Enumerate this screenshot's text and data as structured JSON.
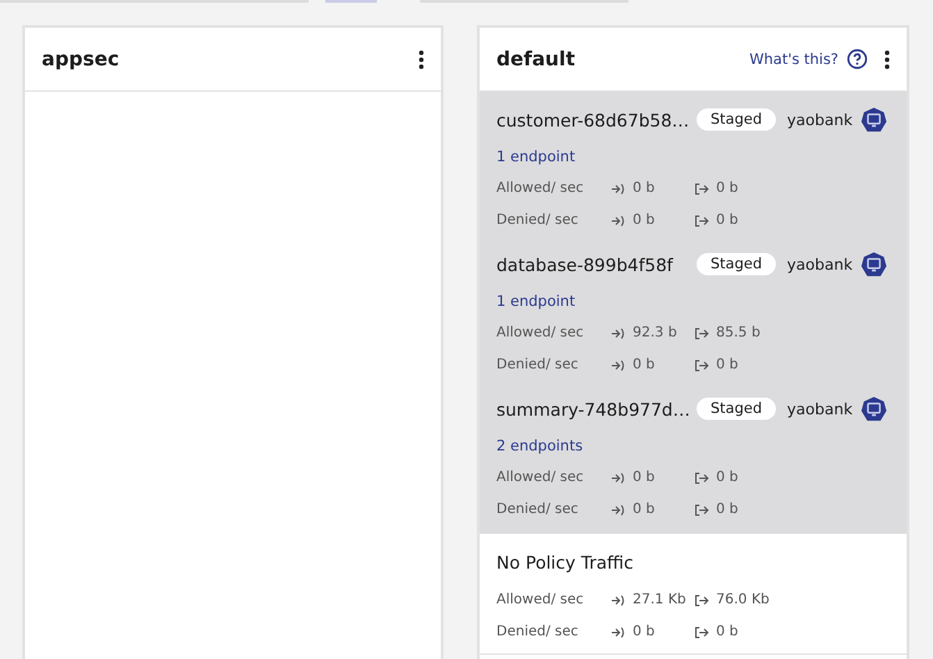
{
  "tiers": [
    {
      "name": "appsec"
    },
    {
      "name": "default",
      "help_link": "What's this?",
      "policies": [
        {
          "name": "customer-68d67b58…",
          "badge": "Staged",
          "namespace": "yaobank",
          "endpoints": "1 endpoint",
          "allowed_label": "Allowed/ sec",
          "allowed_in": "0 b",
          "allowed_out": "0 b",
          "denied_label": "Denied/ sec",
          "denied_in": "0 b",
          "denied_out": "0 b"
        },
        {
          "name": "database-899b4f58f",
          "badge": "Staged",
          "namespace": "yaobank",
          "endpoints": "1 endpoint",
          "allowed_label": "Allowed/ sec",
          "allowed_in": "92.3 b",
          "allowed_out": "85.5 b",
          "denied_label": "Denied/ sec",
          "denied_in": "0 b",
          "denied_out": "0 b"
        },
        {
          "name": "summary-748b977d…",
          "badge": "Staged",
          "namespace": "yaobank",
          "endpoints": "2 endpoints",
          "allowed_label": "Allowed/ sec",
          "allowed_in": "0 b",
          "allowed_out": "0 b",
          "denied_label": "Denied/ sec",
          "denied_in": "0 b",
          "denied_out": "0 b"
        }
      ],
      "no_policy_traffic": {
        "title": "No Policy Traffic",
        "allowed_label": "Allowed/ sec",
        "allowed_in": "27.1 Kb",
        "allowed_out": "76.0 Kb",
        "denied_label": "Denied/ sec",
        "denied_in": "0 b",
        "denied_out": "0 b"
      }
    }
  ]
}
